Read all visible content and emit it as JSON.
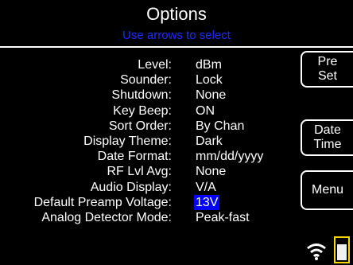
{
  "header": {
    "title": "Options",
    "subtitle": "Use arrows to select"
  },
  "options": [
    {
      "label": "Level:",
      "value": "dBm"
    },
    {
      "label": "Sounder:",
      "value": "Lock"
    },
    {
      "label": "Shutdown:",
      "value": "None"
    },
    {
      "label": "Key Beep:",
      "value": "ON"
    },
    {
      "label": "Sort Order:",
      "value": "By Chan"
    },
    {
      "label": "Display Theme:",
      "value": "Dark"
    },
    {
      "label": "Date Format:",
      "value": "mm/dd/yyyy"
    },
    {
      "label": "RF Lvl Avg:",
      "value": "None"
    },
    {
      "label": "Audio Display:",
      "value": "V/A"
    },
    {
      "label": "Default Preamp Voltage:",
      "value": "13V",
      "selected": true
    },
    {
      "label": "Analog Detector Mode:",
      "value": "Peak-fast"
    }
  ],
  "softkeys": {
    "preset": {
      "line1": "Pre",
      "line2": "Set"
    },
    "datetime": {
      "line1": "Date",
      "line2": "Time"
    },
    "menu": {
      "line1": "Menu"
    }
  },
  "status": {
    "wifi_icon": "wifi-icon",
    "battery_icon": "battery-icon",
    "battery_level": 0.75,
    "battery_color": "#ffd700"
  },
  "colors": {
    "background": "#000000",
    "text": "#ffffff",
    "subtitle": "#1c2bff",
    "selection": "#0000ff"
  }
}
